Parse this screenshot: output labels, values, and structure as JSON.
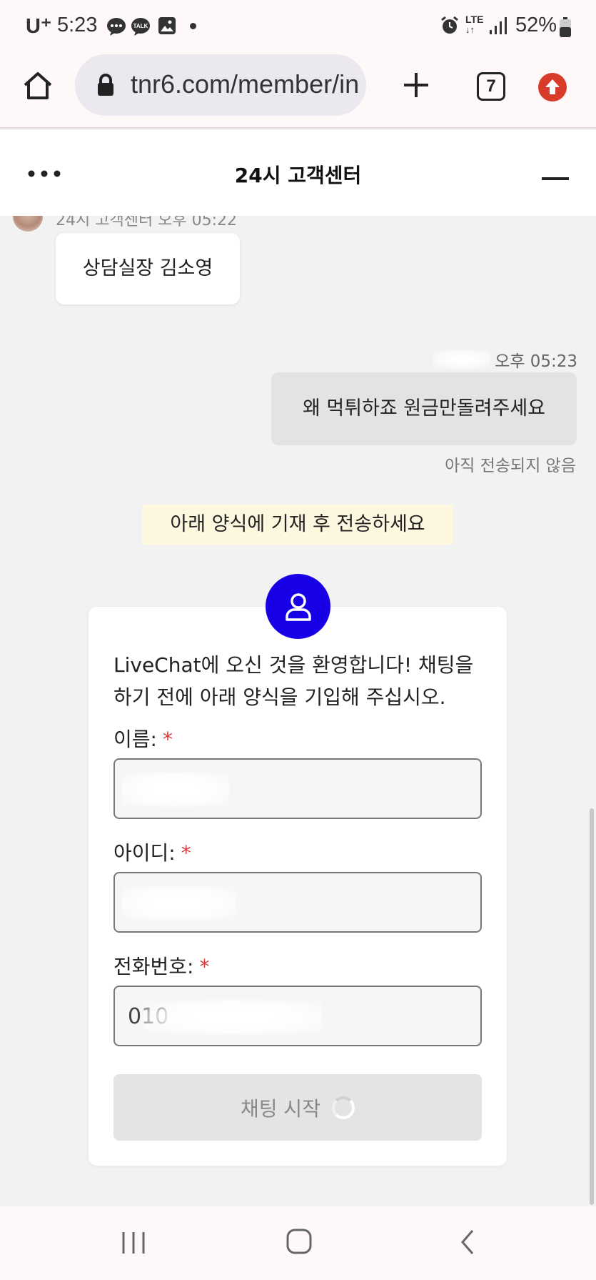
{
  "status_bar": {
    "carrier": "U⁺",
    "time": "5:23",
    "battery": "52%",
    "network": "LTE"
  },
  "browser": {
    "url": "tnr6.com/member/in",
    "tab_count": "7",
    "icons": [
      "home-icon",
      "lock-icon",
      "new-tab-icon",
      "tabs-icon",
      "update-icon"
    ]
  },
  "chat_header": {
    "title": "24시 고객센터",
    "icons": [
      "more-icon",
      "minimize-icon"
    ]
  },
  "messages": {
    "agent_meta": "24시 고객센터 오후 05:22",
    "agent_text": "상담실장 김소영",
    "user_time": "오후 05:23",
    "user_text": "왜 먹튀하죠 원금만돌려주세요",
    "user_status": "아직 전송되지 않음"
  },
  "notice": "아래 양식에 기재 후 전송하세요",
  "form": {
    "welcome": "LiveChat에 오신 것을 환영합니다! 채팅을 하기 전에 아래 양식을 기입해 주십시오.",
    "required_mark": "*",
    "name_label": "이름:",
    "id_label": "아이디:",
    "phone_label": "전화번호:",
    "phone_value_visible": "010",
    "submit_label": "채팅 시작"
  },
  "colors": {
    "accent": "#1700e6",
    "required": "#d93b3b",
    "update_badge": "#d93b2b"
  }
}
